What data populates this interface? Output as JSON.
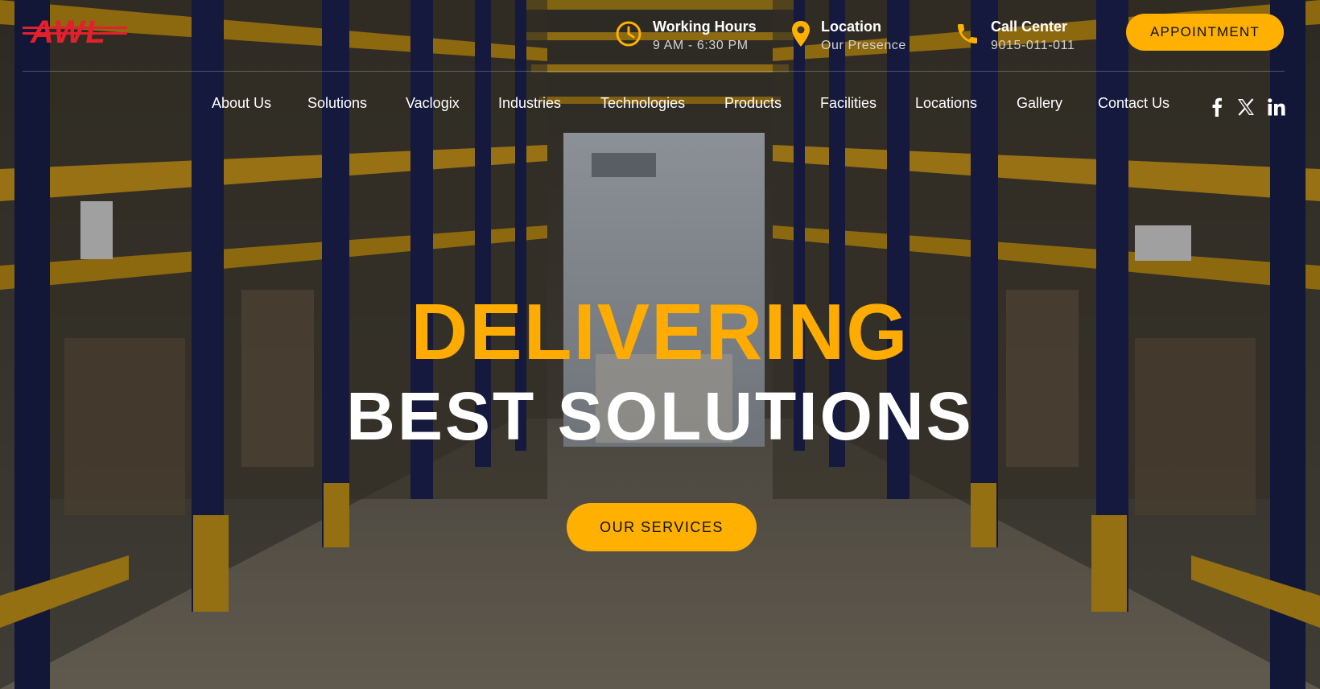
{
  "brand": {
    "logo_text": "AWL",
    "accent": "#ffb000",
    "logo_color": "#e3202b"
  },
  "header": {
    "info": [
      {
        "icon": "clock-icon",
        "title": "Working Hours",
        "detail": "9 AM - 6:30 PM"
      },
      {
        "icon": "map-pin-icon",
        "title": "Location",
        "detail": "Our Presence"
      },
      {
        "icon": "phone-icon",
        "title": "Call Center",
        "detail": "9015-011-011"
      }
    ],
    "appointment_label": "APPOINTMENT"
  },
  "nav": {
    "items": [
      "About Us",
      "Solutions",
      "Vaclogix",
      "Industries",
      "Technologies",
      "Products",
      "Facilities",
      "Locations",
      "Gallery",
      "Contact Us"
    ],
    "social": [
      "facebook-icon",
      "x-icon",
      "linkedin-icon"
    ]
  },
  "hero": {
    "line1": "DELIVERING",
    "line2": "BEST SOLUTIONS",
    "cta_label": "OUR SERVICES"
  }
}
